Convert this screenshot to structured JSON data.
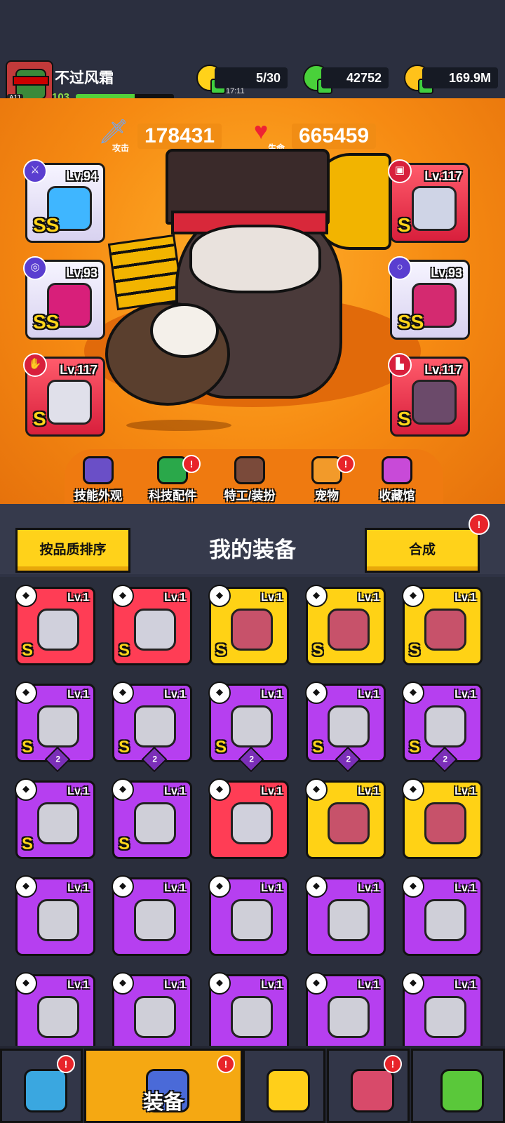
{
  "player": {
    "name": "不过风霜",
    "level": "103",
    "rank_badge": "A11",
    "xp_fraction": 0.6
  },
  "resources": {
    "energy": {
      "value": "5/30",
      "timer": "17:11",
      "icon": "lightning-icon"
    },
    "gems": {
      "value": "42752",
      "icon": "gem-icon"
    },
    "coins": {
      "value": "169.9M",
      "icon": "coin-icon"
    }
  },
  "stats": {
    "attack": {
      "label": "攻击",
      "value": "178431",
      "icon": "sword-icon"
    },
    "health": {
      "label": "生命",
      "value": "665459",
      "icon": "heart-icon"
    }
  },
  "equipped": [
    {
      "slot": "weapon",
      "level": "Lv.94",
      "grade": "SS",
      "rarity": "silver"
    },
    {
      "slot": "armor",
      "level": "Lv.117",
      "grade": "S",
      "rarity": "red"
    },
    {
      "slot": "necklace",
      "level": "Lv.93",
      "grade": "SS",
      "rarity": "silver"
    },
    {
      "slot": "belt",
      "level": "Lv.93",
      "grade": "SS",
      "rarity": "silver"
    },
    {
      "slot": "gloves",
      "level": "Lv.117",
      "grade": "S",
      "rarity": "red"
    },
    {
      "slot": "boots",
      "level": "Lv.117",
      "grade": "S",
      "rarity": "red"
    }
  ],
  "subnav": [
    {
      "label": "技能外观",
      "badge": false
    },
    {
      "label": "科技配件",
      "badge": true
    },
    {
      "label": "特工/装扮",
      "badge": false
    },
    {
      "label": "宠物",
      "badge": true
    },
    {
      "label": "收藏馆",
      "badge": false
    }
  ],
  "actions": {
    "sort_label": "按品质排序",
    "title": "我的装备",
    "merge_label": "合成",
    "badge": "!"
  },
  "inventory": [
    {
      "rarity": "red",
      "level": "Lv.1",
      "grade": "S",
      "stack": ""
    },
    {
      "rarity": "red",
      "level": "Lv.1",
      "grade": "S",
      "stack": ""
    },
    {
      "rarity": "gold",
      "level": "Lv.1",
      "grade": "S",
      "stack": ""
    },
    {
      "rarity": "gold",
      "level": "Lv.1",
      "grade": "S",
      "stack": ""
    },
    {
      "rarity": "gold",
      "level": "Lv.1",
      "grade": "S",
      "stack": ""
    },
    {
      "rarity": "purple",
      "level": "Lv.1",
      "grade": "S",
      "stack": "2"
    },
    {
      "rarity": "purple",
      "level": "Lv.1",
      "grade": "S",
      "stack": "2"
    },
    {
      "rarity": "purple",
      "level": "Lv.1",
      "grade": "S",
      "stack": "2"
    },
    {
      "rarity": "purple",
      "level": "Lv.1",
      "grade": "S",
      "stack": "2"
    },
    {
      "rarity": "purple",
      "level": "Lv.1",
      "grade": "S",
      "stack": "2"
    },
    {
      "rarity": "purple",
      "level": "Lv.1",
      "grade": "S",
      "stack": ""
    },
    {
      "rarity": "purple",
      "level": "Lv.1",
      "grade": "S",
      "stack": ""
    },
    {
      "rarity": "red",
      "level": "Lv.1",
      "grade": "",
      "stack": ""
    },
    {
      "rarity": "gold",
      "level": "Lv.1",
      "grade": "",
      "stack": ""
    },
    {
      "rarity": "gold",
      "level": "Lv.1",
      "grade": "",
      "stack": ""
    },
    {
      "rarity": "purple",
      "level": "Lv.1",
      "grade": "",
      "stack": ""
    },
    {
      "rarity": "purple",
      "level": "Lv.1",
      "grade": "",
      "stack": ""
    },
    {
      "rarity": "purple",
      "level": "Lv.1",
      "grade": "",
      "stack": ""
    },
    {
      "rarity": "purple",
      "level": "Lv.1",
      "grade": "",
      "stack": ""
    },
    {
      "rarity": "purple",
      "level": "Lv.1",
      "grade": "",
      "stack": ""
    },
    {
      "rarity": "purple",
      "level": "Lv.1",
      "grade": "",
      "stack": ""
    },
    {
      "rarity": "purple",
      "level": "Lv.1",
      "grade": "",
      "stack": ""
    },
    {
      "rarity": "purple",
      "level": "Lv.1",
      "grade": "",
      "stack": ""
    },
    {
      "rarity": "purple",
      "level": "Lv.1",
      "grade": "",
      "stack": ""
    },
    {
      "rarity": "purple",
      "level": "Lv.1",
      "grade": "",
      "stack": ""
    }
  ],
  "bottomnav": [
    {
      "name": "shop",
      "label": "",
      "badge": true,
      "active": false
    },
    {
      "name": "equipment",
      "label": "装备",
      "badge": true,
      "active": true
    },
    {
      "name": "battle",
      "label": "",
      "badge": false,
      "active": false
    },
    {
      "name": "events",
      "label": "",
      "badge": true,
      "active": false
    },
    {
      "name": "lab",
      "label": "",
      "badge": false,
      "active": false
    }
  ],
  "colors": {
    "hero_bg": "#f68a12",
    "rarity_red": "#ff3d55",
    "rarity_gold": "#ffd215",
    "rarity_purple": "#b63ff0"
  }
}
